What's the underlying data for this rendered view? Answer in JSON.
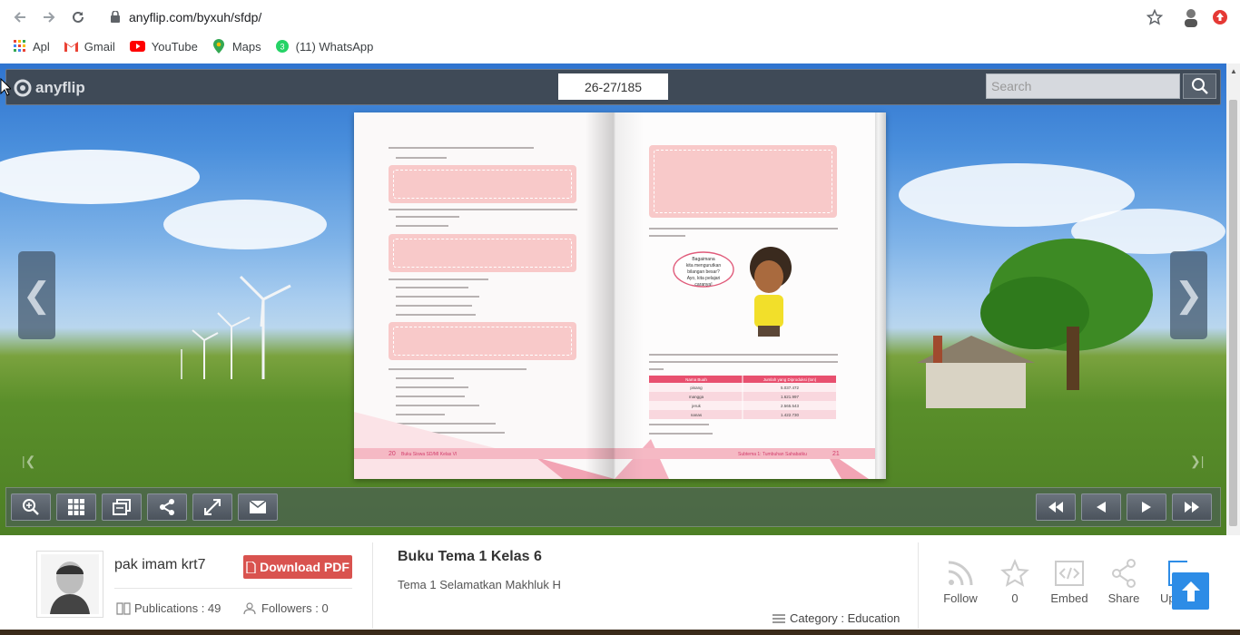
{
  "browser": {
    "url": "anyflip.com/byxuh/sfdp/",
    "bookmarks": [
      {
        "label": "Apl",
        "icon": "apps-grid-icon"
      },
      {
        "label": "Gmail",
        "icon": "gmail-icon"
      },
      {
        "label": "YouTube",
        "icon": "youtube-icon"
      },
      {
        "label": "Maps",
        "icon": "maps-pin-icon"
      },
      {
        "label": "(11) WhatsApp",
        "icon": "whatsapp-icon"
      }
    ]
  },
  "viewer": {
    "logo": "anyflip",
    "page_indicator": "26-27/185",
    "search_placeholder": "Search"
  },
  "book_pages": {
    "left_footer": "20",
    "left_footer_title": "Buku Siswa SD/MI Kelas VI",
    "right_footer": "21",
    "right_footer_title": "Subtema 1: Tumbuhan Sahabatku",
    "speech": "Bagaimana kita mengurutkan bilangan besar? Ayo, kita pelajari caranya!",
    "table_head": [
      "Nama Buah",
      "Jumlah yang Diproduksi (ton)"
    ],
    "table_rows": [
      [
        "pisang",
        "5.037.472"
      ],
      [
        "mangga",
        "1.621.997"
      ],
      [
        "jeruk",
        "2.565.543"
      ],
      [
        "nanas",
        "1.422.730"
      ]
    ]
  },
  "info": {
    "author": "pak imam krt7",
    "download_label": "Download PDF",
    "publications": "Publications : 49",
    "followers": "Followers : 0",
    "book_title": "Buku Tema 1 Kelas 6",
    "book_desc": "Tema 1 Selamatkan Makhluk H",
    "category": "Category : Education",
    "actions": {
      "follow": "Follow",
      "like_count": "0",
      "embed": "Embed",
      "share": "Share",
      "upload": "Up"
    }
  }
}
